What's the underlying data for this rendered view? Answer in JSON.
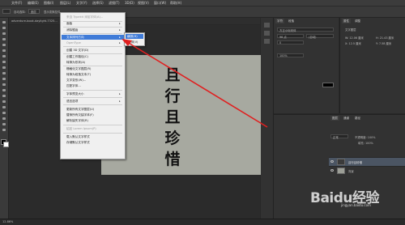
{
  "menubar": {
    "items": [
      "文件(F)",
      "编辑(E)",
      "图像(I)",
      "图层(L)",
      "文字(Y)",
      "选择(S)",
      "滤镜(T)",
      "3D(D)",
      "视图(V)",
      "窗口(W)",
      "帮助(H)"
    ]
  },
  "optionsbar": {
    "label1": "自动选择:",
    "label2": "图层",
    "label3": "显示变换控件"
  },
  "document": {
    "tab_label": "adventure-book-daylight-7325..."
  },
  "canvas": {
    "chars": [
      "且",
      "行",
      "且",
      "珍",
      "惜"
    ],
    "bg_color": "#a7a9a0"
  },
  "context_menu": {
    "header": "来自 Typekit 添加字体(A)...",
    "items": [
      "面板",
      "消除锯齿",
      "文本排列方向",
      "OpenType",
      "创建 3D 文字(D)",
      "创建工作路径(C)",
      "转换为形状(A)",
      "栅格化文字图层(R)",
      "转换为段落文本(T)",
      "文字变形(W)...",
      "匹配字体...",
      "字体预览大小",
      "语言选项",
      "更新所有文字图层(U)",
      "替换所有欠缺字体(F)",
      "解析缺失字体(R)",
      "粘贴 Lorem Ipsum(P)",
      "载入默认文字样式",
      "存储默认文字样式"
    ]
  },
  "submenu": {
    "items": [
      "横排(H)",
      "竖排(V)"
    ]
  },
  "char_panel": {
    "tabs": [
      "字符",
      "段落"
    ],
    "font": "方正小标宋体",
    "size": "96 点",
    "leading": "(自动)",
    "tracking": "0",
    "scale": "100%"
  },
  "props_panel": {
    "tabs": [
      "属性",
      "调整"
    ],
    "title": "文字图层",
    "w": "W: 12.06 厘米",
    "h": "H: 21.43 厘米",
    "x": "X: 12.5 厘米",
    "y": "Y: 7.58 厘米"
  },
  "layers_panel": {
    "tabs": [
      "图层",
      "通道",
      "路径"
    ],
    "mode": "正常",
    "opacity": "不透明度: 100%",
    "fill": "填充: 100%",
    "layers": [
      "且行且珍惜",
      "背景"
    ]
  },
  "statusbar": {
    "zoom": "12.86%"
  },
  "watermark": {
    "text": "Baidu经验",
    "url": "jingyan.baidu.com"
  },
  "colors": {
    "highlight": "#3f7bd8",
    "annotation_arrow": "#e02020"
  }
}
